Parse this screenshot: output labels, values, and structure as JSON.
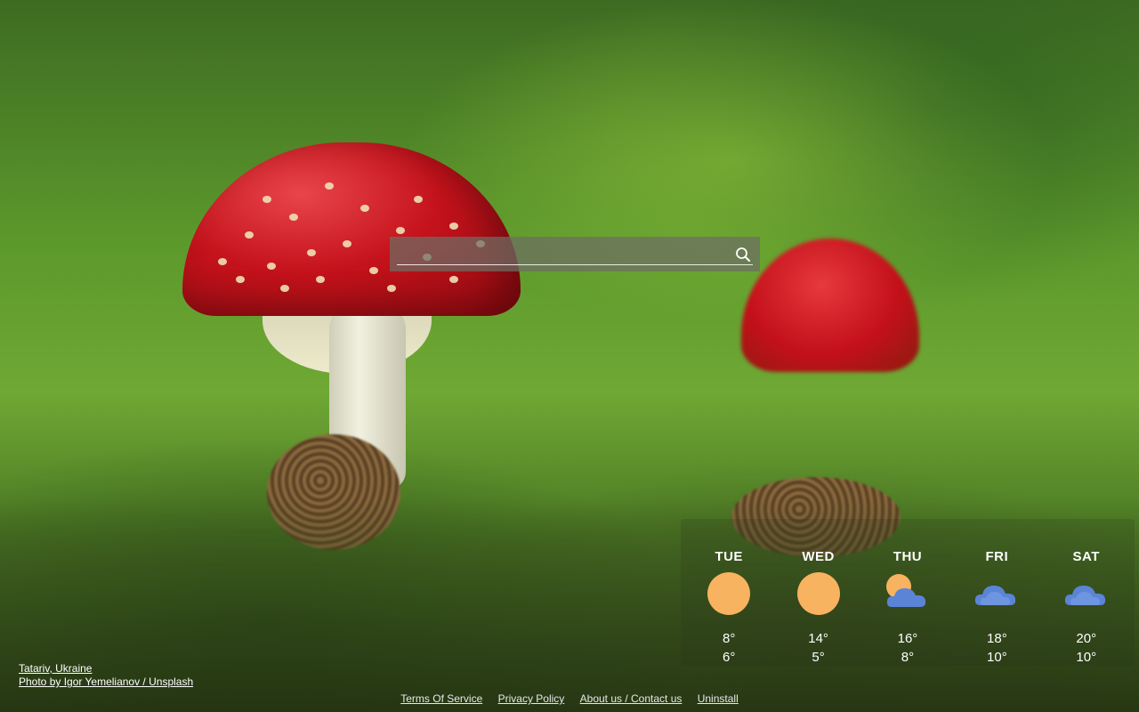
{
  "search": {
    "value": "",
    "placeholder": "",
    "icon": "search-icon"
  },
  "weather": {
    "days": [
      {
        "day": "TUE",
        "icon": "sun-icon",
        "high": "8°",
        "low": "6°"
      },
      {
        "day": "WED",
        "icon": "sun-icon",
        "high": "14°",
        "low": "5°"
      },
      {
        "day": "THU",
        "icon": "partly-cloudy-icon",
        "high": "16°",
        "low": "8°"
      },
      {
        "day": "FRI",
        "icon": "cloud-icon",
        "high": "18°",
        "low": "10°"
      },
      {
        "day": "SAT",
        "icon": "cloud-icon",
        "high": "20°",
        "low": "10°"
      }
    ],
    "colors": {
      "sun": "#f7b360",
      "cloud": "#5b84d6"
    }
  },
  "credit": {
    "location": "Tatariv, Ukraine",
    "photo": "Photo by Igor Yemelianov / Unsplash"
  },
  "footer": {
    "links": [
      "Terms Of Service",
      "Privacy Policy",
      "About us / Contact us",
      "Uninstall"
    ]
  }
}
